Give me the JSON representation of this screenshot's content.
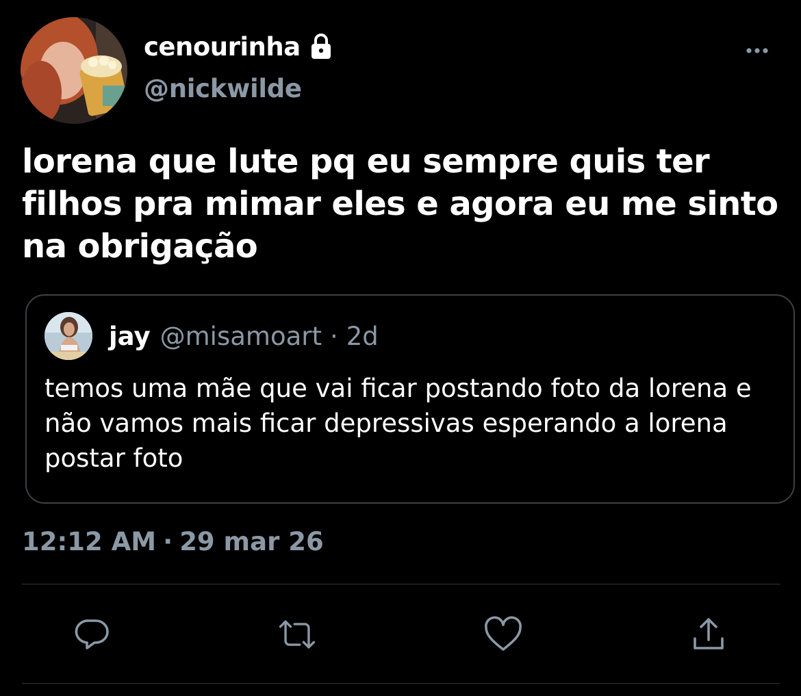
{
  "author": {
    "display_name": "cenourinha",
    "handle": "@nickwilde",
    "avatar": "avatar-photo",
    "protected_icon": "lock-icon"
  },
  "menu_icon": "more-icon",
  "tweet": {
    "text": "lorena que lute pq eu sempre quis ter filhos pra mimar eles e agora eu me sinto na obrigação"
  },
  "quoted_tweet": {
    "display_name": "jay",
    "handle": "@misamoart",
    "separator": "·",
    "time": "2d",
    "text": "temos uma mãe que vai ficar postando foto da lorena e não vamos mais ficar depressivas esperando a lorena postar foto",
    "avatar": "avatar-photo"
  },
  "timestamp": {
    "time": "12:12 AM",
    "separator": "·",
    "date": "29 mar 26"
  },
  "actions": [
    {
      "icon": "reply-icon"
    },
    {
      "icon": "retweet-icon"
    },
    {
      "icon": "like-icon"
    },
    {
      "icon": "share-icon"
    }
  ],
  "colors": {
    "background": "#000000",
    "primary_text": "#ffffff",
    "secondary_text": "#8b98a5",
    "border": "#3e4144",
    "divider": "#2f3336"
  }
}
